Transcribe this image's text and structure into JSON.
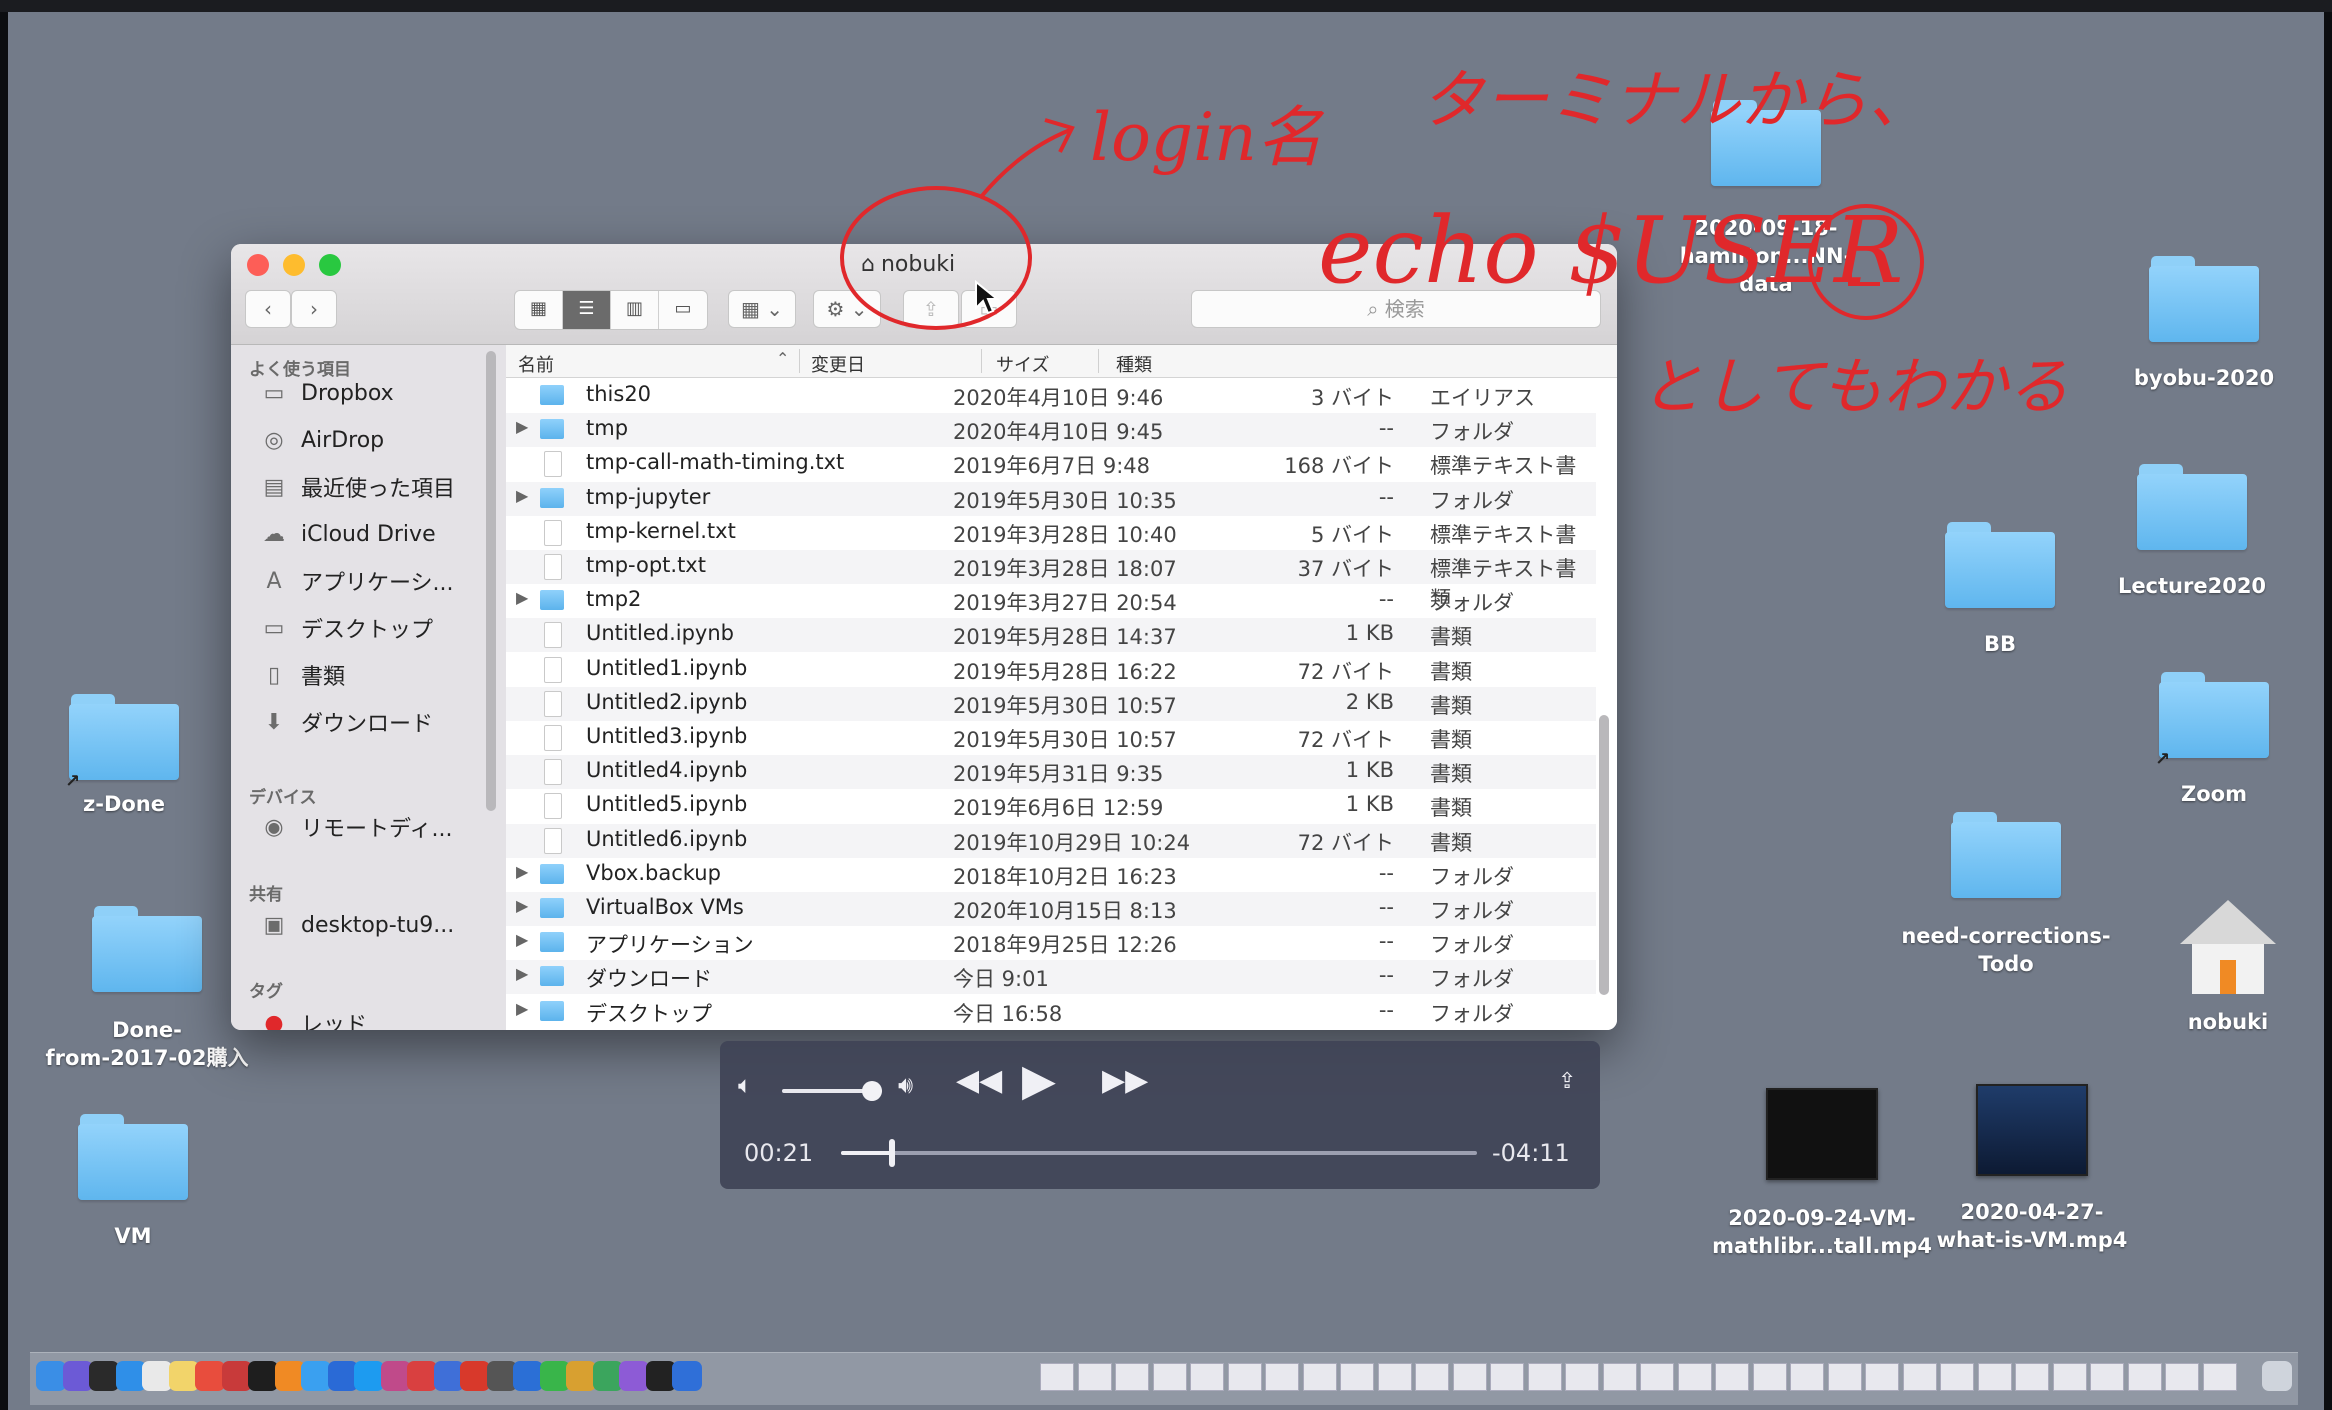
{
  "desktop": {
    "icons": [
      {
        "label": "z-Done"
      },
      {
        "label_line1": "Done-",
        "label_line2": "from-2017-02購入"
      },
      {
        "label": "VM"
      },
      {
        "label_line1": "2020-09-18-",
        "label_line2": "hamilton...NN-data"
      },
      {
        "label": "byobu-2020"
      },
      {
        "label": "Lecture2020"
      },
      {
        "label": "BB"
      },
      {
        "label": "Zoom"
      },
      {
        "label_line1": "need-corrections-",
        "label_line2": "Todo"
      },
      {
        "label": "nobuki"
      },
      {
        "label_line1": "2020-09-24-VM-",
        "label_line2": "mathlibr...tall.mp4"
      },
      {
        "label_line1": "2020-04-27-",
        "label_line2": "what-is-VM.mp4"
      }
    ]
  },
  "finder": {
    "title": "nobuki",
    "search_placeholder": "検索",
    "sidebar": {
      "favorites_header": "よく使う項目",
      "favorites": [
        {
          "label": "Dropbox",
          "icon": "folder-icon"
        },
        {
          "label": "AirDrop",
          "icon": "airdrop-icon"
        },
        {
          "label": "最近使った項目",
          "icon": "recents-icon"
        },
        {
          "label": "iCloud Drive",
          "icon": "cloud-icon"
        },
        {
          "label": "アプリケーシ...",
          "icon": "applications-icon"
        },
        {
          "label": "デスクトップ",
          "icon": "desktop-icon"
        },
        {
          "label": "書類",
          "icon": "documents-icon"
        },
        {
          "label": "ダウンロード",
          "icon": "download-icon"
        }
      ],
      "devices_header": "デバイス",
      "devices": [
        {
          "label": "リモートディ...",
          "icon": "disc-icon"
        }
      ],
      "shared_header": "共有",
      "shared": [
        {
          "label": "desktop-tu9...",
          "icon": "computer-icon"
        }
      ],
      "tags_header": "タグ",
      "tag_partial": "レッド"
    },
    "columns": {
      "name": "名前",
      "modified": "変更日",
      "size": "サイズ",
      "kind": "種類"
    },
    "rows": [
      {
        "name": "this20",
        "date": "2020年4月10日 9:46",
        "size": "3 バイト",
        "kind": "エイリアス",
        "type": "alias"
      },
      {
        "name": "tmp",
        "date": "2020年4月10日 9:45",
        "size": "--",
        "kind": "フォルダ",
        "type": "folder"
      },
      {
        "name": "tmp-call-math-timing.txt",
        "date": "2019年6月7日 9:48",
        "size": "168 バイト",
        "kind": "標準テキスト書類",
        "type": "file"
      },
      {
        "name": "tmp-jupyter",
        "date": "2019年5月30日 10:35",
        "size": "--",
        "kind": "フォルダ",
        "type": "folder"
      },
      {
        "name": "tmp-kernel.txt",
        "date": "2019年3月28日 10:40",
        "size": "5 バイト",
        "kind": "標準テキスト書類",
        "type": "file"
      },
      {
        "name": "tmp-opt.txt",
        "date": "2019年3月28日 18:07",
        "size": "37 バイト",
        "kind": "標準テキスト書類",
        "type": "file"
      },
      {
        "name": "tmp2",
        "date": "2019年3月27日 20:54",
        "size": "--",
        "kind": "フォルダ",
        "type": "folder"
      },
      {
        "name": "Untitled.ipynb",
        "date": "2019年5月28日 14:37",
        "size": "1 KB",
        "kind": "書類",
        "type": "file"
      },
      {
        "name": "Untitled1.ipynb",
        "date": "2019年5月28日 16:22",
        "size": "72 バイト",
        "kind": "書類",
        "type": "file"
      },
      {
        "name": "Untitled2.ipynb",
        "date": "2019年5月30日 10:57",
        "size": "2 KB",
        "kind": "書類",
        "type": "file"
      },
      {
        "name": "Untitled3.ipynb",
        "date": "2019年5月30日 10:57",
        "size": "72 バイト",
        "kind": "書類",
        "type": "file"
      },
      {
        "name": "Untitled4.ipynb",
        "date": "2019年5月31日 9:35",
        "size": "1 KB",
        "kind": "書類",
        "type": "file"
      },
      {
        "name": "Untitled5.ipynb",
        "date": "2019年6月6日 12:59",
        "size": "1 KB",
        "kind": "書類",
        "type": "file"
      },
      {
        "name": "Untitled6.ipynb",
        "date": "2019年10月29日 10:24",
        "size": "72 バイト",
        "kind": "書類",
        "type": "file"
      },
      {
        "name": "Vbox.backup",
        "date": "2018年10月2日 16:23",
        "size": "--",
        "kind": "フォルダ",
        "type": "folder"
      },
      {
        "name": "VirtualBox VMs",
        "date": "2020年10月15日 8:13",
        "size": "--",
        "kind": "フォルダ",
        "type": "folder"
      },
      {
        "name": "アプリケーション",
        "date": "2018年9月25日 12:26",
        "size": "--",
        "kind": "フォルダ",
        "type": "folder"
      },
      {
        "name": "ダウンロード",
        "date": "今日 9:01",
        "size": "--",
        "kind": "フォルダ",
        "type": "folder"
      },
      {
        "name": "デスクトップ",
        "date": "今日 16:58",
        "size": "--",
        "kind": "フォルダ",
        "type": "folder"
      }
    ]
  },
  "player": {
    "elapsed": "00:21",
    "remaining": "-04:11",
    "progress_fraction": 0.08,
    "volume_fraction": 0.9
  },
  "annotations": {
    "login_label": "login名",
    "terminal_label": "ターミナルから、",
    "command": "echo $USER",
    "result_label": "としてもわかる"
  },
  "colors": {
    "desktop": "#737b89",
    "folder": "#7fc6f5",
    "annotation": "#e0282b",
    "close": "#fd5e57",
    "minimize": "#febc2e",
    "zoom": "#29c840"
  }
}
